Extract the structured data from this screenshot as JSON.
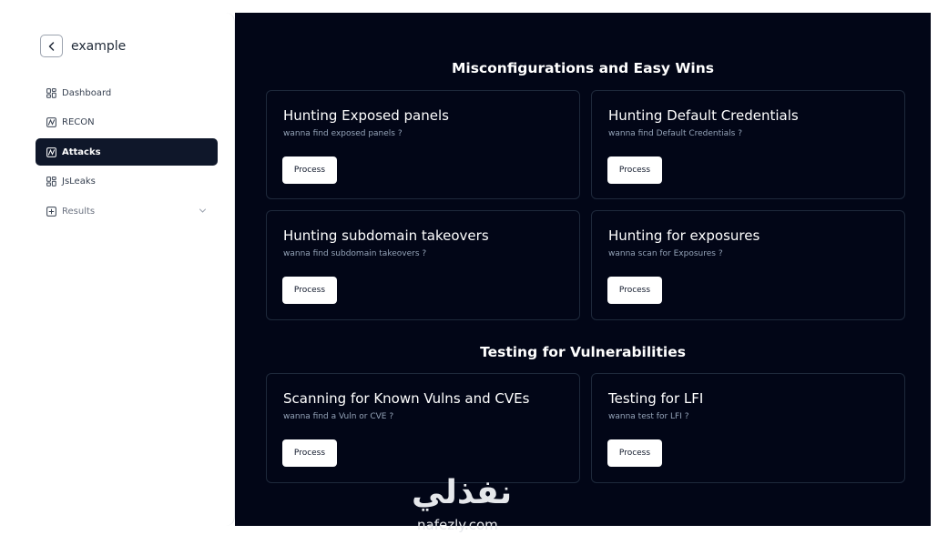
{
  "sidebar": {
    "title": "example",
    "items": [
      {
        "label": "Dashboard",
        "icon": "grid-icon",
        "active": false
      },
      {
        "label": "RECON",
        "icon": "activity-icon",
        "active": false
      },
      {
        "label": "Attacks",
        "icon": "activity-icon",
        "active": true
      },
      {
        "label": "JsLeaks",
        "icon": "grid-icon",
        "active": false
      },
      {
        "label": "Results",
        "icon": "plus-square-icon",
        "active": false,
        "expandable": true
      }
    ]
  },
  "sections": [
    {
      "title": "Misconfigurations and Easy Wins",
      "cards": [
        {
          "title": "Hunting Exposed panels",
          "subtitle": "wanna find exposed panels ?",
          "button": "Process"
        },
        {
          "title": "Hunting Default Credentials",
          "subtitle": "wanna find Default Credentials ?",
          "button": "Process"
        },
        {
          "title": "Hunting subdomain takeovers",
          "subtitle": "wanna find subdomain takeovers ?",
          "button": "Process"
        },
        {
          "title": "Hunting for exposures",
          "subtitle": "wanna scan for Exposures ?",
          "button": "Process"
        }
      ]
    },
    {
      "title": "Testing for Vulnerabilities",
      "cards": [
        {
          "title": "Scanning for Known Vulns and CVEs",
          "subtitle": "wanna find a Vuln or CVE ?",
          "button": "Process"
        },
        {
          "title": "Testing for LFI",
          "subtitle": "wanna test for LFI ?",
          "button": "Process"
        }
      ]
    }
  ],
  "watermark": {
    "arabic": "نفذلي",
    "url": "nafezly.com"
  },
  "colors": {
    "main_bg": "#020617",
    "active_nav_bg": "#0f172a",
    "card_border": "#1e293b",
    "subtitle": "#94a3b8"
  }
}
